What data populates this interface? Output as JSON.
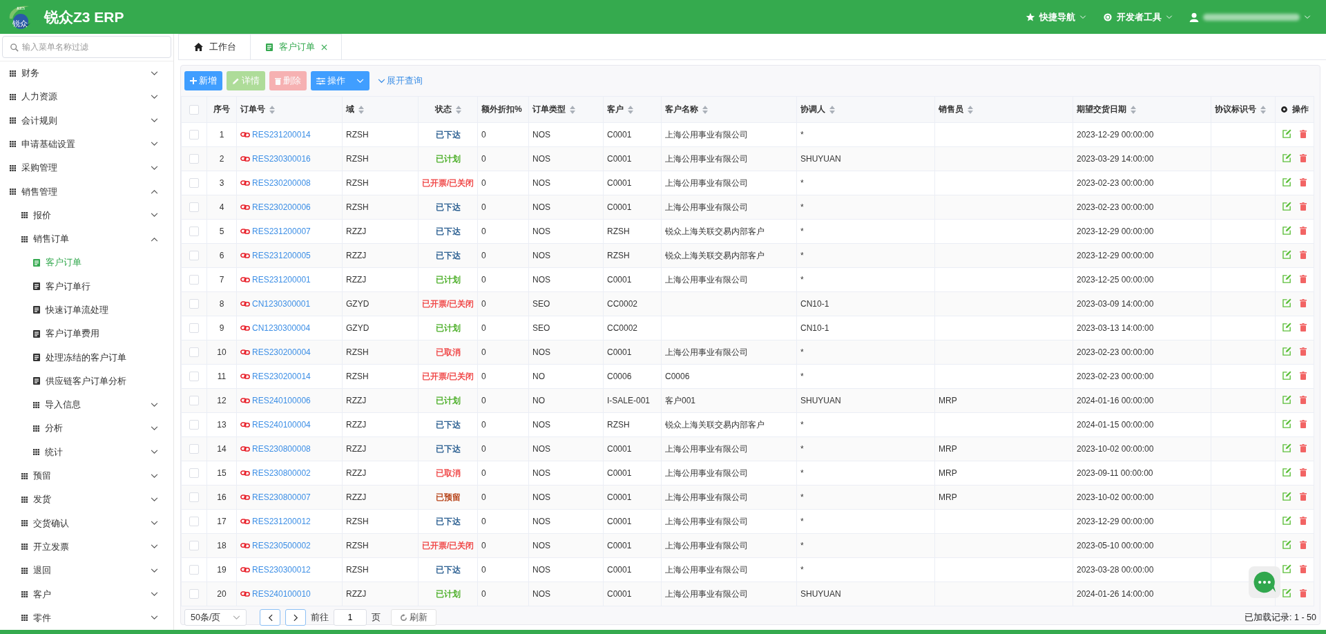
{
  "header": {
    "logo_text": [
      "RES",
      "锐众"
    ],
    "title": "锐众Z3 ERP",
    "menus": [
      {
        "kind": "star",
        "label": "快捷导航"
      },
      {
        "kind": "dev",
        "label": "开发者工具"
      },
      {
        "kind": "user"
      }
    ]
  },
  "sidebar": {
    "search": {
      "placeholder": "输入菜单名称过滤"
    },
    "items": [
      {
        "kind": "folder",
        "label": "财务",
        "expanded": false
      },
      {
        "kind": "folder",
        "label": "人力资源",
        "expanded": false
      },
      {
        "kind": "folder",
        "label": "会计规则",
        "expanded": false
      },
      {
        "kind": "folder",
        "label": "申请基础设置",
        "expanded": false
      },
      {
        "kind": "folder",
        "label": "采购管理",
        "expanded": false
      },
      {
        "kind": "folder",
        "label": "销售管理",
        "expanded": true,
        "children": [
          {
            "kind": "folder",
            "label": "报价",
            "expanded": false
          },
          {
            "kind": "folder",
            "label": "销售订单",
            "expanded": true,
            "children": [
              {
                "kind": "page",
                "label": "客户订单",
                "selected": true
              },
              {
                "kind": "page",
                "label": "客户订单行",
                "selected": false
              },
              {
                "kind": "page",
                "label": "快速订单流处理",
                "selected": false
              },
              {
                "kind": "page",
                "label": "客户订单费用",
                "selected": false
              },
              {
                "kind": "page",
                "label": "处理冻结的客户订单",
                "selected": false
              },
              {
                "kind": "page",
                "label": "供应链客户订单分析",
                "selected": false
              },
              {
                "kind": "folder",
                "label": "导入信息",
                "expanded": false
              },
              {
                "kind": "folder",
                "label": "分析",
                "expanded": false
              },
              {
                "kind": "folder",
                "label": "统计",
                "expanded": false
              }
            ]
          },
          {
            "kind": "folder",
            "label": "预留",
            "expanded": false
          },
          {
            "kind": "folder",
            "label": "发货",
            "expanded": false
          },
          {
            "kind": "folder",
            "label": "交货确认",
            "expanded": false
          },
          {
            "kind": "folder",
            "label": "开立发票",
            "expanded": false
          },
          {
            "kind": "folder",
            "label": "退回",
            "expanded": false
          },
          {
            "kind": "folder",
            "label": "客户",
            "expanded": false
          },
          {
            "kind": "folder",
            "label": "零件",
            "expanded": false
          }
        ]
      }
    ]
  },
  "tabs": [
    {
      "kind": "home",
      "label": "工作台",
      "selected": false,
      "closable": false
    },
    {
      "kind": "doc",
      "label": "客户订单",
      "selected": true,
      "closable": true
    }
  ],
  "toolbar": {
    "buttons": [
      {
        "kind": "add",
        "label": "新增",
        "disabled": false
      },
      {
        "kind": "edit",
        "label": "详情",
        "disabled": true
      },
      {
        "kind": "delete",
        "label": "删除",
        "disabled": true
      },
      {
        "kind": "menu",
        "label": "操作",
        "disabled": false
      }
    ],
    "expand_link": "展开查询"
  },
  "table": {
    "select_all_checked": false,
    "columns": [
      {
        "label": "序号",
        "sortable": false
      },
      {
        "label": "订单号",
        "sortable": true
      },
      {
        "label": "域",
        "sortable": true
      },
      {
        "label": "状态",
        "sortable": true
      },
      {
        "label": "额外折扣%",
        "sortable": false
      },
      {
        "label": "订单类型",
        "sortable": true
      },
      {
        "label": "客户",
        "sortable": true
      },
      {
        "label": "客户名称",
        "sortable": true
      },
      {
        "label": "协调人",
        "sortable": true
      },
      {
        "label": "销售员",
        "sortable": true
      },
      {
        "label": "期望交货日期",
        "sortable": true
      },
      {
        "label": "协议标识号",
        "sortable": true
      },
      {
        "label": "操作",
        "sortable": false
      }
    ],
    "rows": [
      {
        "checked": false,
        "cells": [
          "1",
          "RES231200014",
          "RZSH",
          "已下达",
          "0",
          "NOS",
          "C0001",
          "上海公用事业有限公司",
          "*",
          "",
          "2023-12-29 00:00:00",
          ""
        ],
        "color": "#2b5f91"
      },
      {
        "checked": false,
        "cells": [
          "2",
          "RES230300016",
          "RZSH",
          "已计划",
          "0",
          "NOS",
          "C0001",
          "上海公用事业有限公司",
          "SHUYUAN",
          "",
          "2023-03-29 14:00:00",
          ""
        ],
        "color": "#4fb02c"
      },
      {
        "checked": false,
        "cells": [
          "3",
          "RES230200008",
          "RZSH",
          "已开票/已关闭",
          "0",
          "NOS",
          "C0001",
          "上海公用事业有限公司",
          "*",
          "",
          "2023-02-23 00:00:00",
          ""
        ],
        "color": "#f04a4a"
      },
      {
        "checked": false,
        "cells": [
          "4",
          "RES230200006",
          "RZSH",
          "已下达",
          "0",
          "NOS",
          "C0001",
          "上海公用事业有限公司",
          "*",
          "",
          "2023-02-23 00:00:00",
          ""
        ],
        "color": "#2b5f91"
      },
      {
        "checked": false,
        "cells": [
          "5",
          "RES231200007",
          "RZZJ",
          "已下达",
          "0",
          "NOS",
          "RZSH",
          "锐众上海关联交易内部客户",
          "*",
          "",
          "2023-12-29 00:00:00",
          ""
        ],
        "color": "#2b5f91"
      },
      {
        "checked": false,
        "cells": [
          "6",
          "RES231200005",
          "RZZJ",
          "已下达",
          "0",
          "NOS",
          "RZSH",
          "锐众上海关联交易内部客户",
          "*",
          "",
          "2023-12-29 00:00:00",
          ""
        ],
        "color": "#2b5f91"
      },
      {
        "checked": false,
        "cells": [
          "7",
          "RES231200001",
          "RZZJ",
          "已计划",
          "0",
          "NOS",
          "C0001",
          "上海公用事业有限公司",
          "*",
          "",
          "2023-12-25 00:00:00",
          ""
        ],
        "color": "#4fb02c"
      },
      {
        "checked": false,
        "cells": [
          "8",
          "CN1230300001",
          "GZYD",
          "已开票/已关闭",
          "0",
          "SEO",
          "CC0002",
          "",
          "CN10-1",
          "",
          "2023-03-09 14:00:00",
          ""
        ],
        "color": "#f04a4a"
      },
      {
        "checked": false,
        "cells": [
          "9",
          "CN1230300004",
          "GZYD",
          "已计划",
          "0",
          "SEO",
          "CC0002",
          "",
          "CN10-1",
          "",
          "2023-03-13 14:00:00",
          ""
        ],
        "color": "#4fb02c"
      },
      {
        "checked": false,
        "cells": [
          "10",
          "RES230200004",
          "RZSH",
          "已取消",
          "0",
          "NOS",
          "C0001",
          "上海公用事业有限公司",
          "*",
          "",
          "2023-02-23 00:00:00",
          ""
        ],
        "color": "#f04a4a"
      },
      {
        "checked": false,
        "cells": [
          "11",
          "RES230200014",
          "RZSH",
          "已开票/已关闭",
          "0",
          "NO",
          "C0006",
          "C0006",
          "*",
          "",
          "2023-02-23 00:00:00",
          ""
        ],
        "color": "#f04a4a"
      },
      {
        "checked": false,
        "cells": [
          "12",
          "RES240100006",
          "RZZJ",
          "已计划",
          "0",
          "NO",
          "I-SALE-001",
          "客户001",
          "SHUYUAN",
          "MRP",
          "2024-01-16 00:00:00",
          ""
        ],
        "color": "#4fb02c"
      },
      {
        "checked": false,
        "cells": [
          "13",
          "RES240100004",
          "RZZJ",
          "已下达",
          "0",
          "NOS",
          "RZSH",
          "锐众上海关联交易内部客户",
          "*",
          "",
          "2024-01-15 00:00:00",
          ""
        ],
        "color": "#2b5f91"
      },
      {
        "checked": false,
        "cells": [
          "14",
          "RES230800008",
          "RZZJ",
          "已下达",
          "0",
          "NOS",
          "C0001",
          "上海公用事业有限公司",
          "*",
          "MRP",
          "2023-10-02 00:00:00",
          ""
        ],
        "color": "#2b5f91"
      },
      {
        "checked": false,
        "cells": [
          "15",
          "RES230800002",
          "RZZJ",
          "已取消",
          "0",
          "NOS",
          "C0001",
          "上海公用事业有限公司",
          "*",
          "MRP",
          "2023-09-11 00:00:00",
          ""
        ],
        "color": "#f04a4a"
      },
      {
        "checked": false,
        "cells": [
          "16",
          "RES230800007",
          "RZZJ",
          "已预留",
          "0",
          "NOS",
          "C0001",
          "上海公用事业有限公司",
          "*",
          "MRP",
          "2023-10-02 00:00:00",
          ""
        ],
        "color": "#b8461c"
      },
      {
        "checked": false,
        "cells": [
          "17",
          "RES231200012",
          "RZSH",
          "已下达",
          "0",
          "NOS",
          "C0001",
          "上海公用事业有限公司",
          "*",
          "",
          "2023-12-29 00:00:00",
          ""
        ],
        "color": "#2b5f91"
      },
      {
        "checked": false,
        "cells": [
          "18",
          "RES230500002",
          "RZSH",
          "已开票/已关闭",
          "0",
          "NOS",
          "C0001",
          "上海公用事业有限公司",
          "*",
          "",
          "2023-05-10 00:00:00",
          ""
        ],
        "color": "#f04a4a"
      },
      {
        "checked": false,
        "cells": [
          "19",
          "RES230300012",
          "RZSH",
          "已下达",
          "0",
          "NOS",
          "C0001",
          "上海公用事业有限公司",
          "*",
          "",
          "2023-03-28 00:00:00",
          ""
        ],
        "color": "#2b5f91"
      },
      {
        "checked": false,
        "cells": [
          "20",
          "RES240100010",
          "RZZJ",
          "已计划",
          "0",
          "NOS",
          "C0001",
          "上海公用事业有限公司",
          "SHUYUAN",
          "",
          "2024-01-26 14:00:00",
          ""
        ],
        "color": "#4fb02c"
      }
    ]
  },
  "pager": {
    "page_size": "50条/页",
    "goto_label": "前往",
    "page": "1",
    "page_unit": "页",
    "refresh": "刷新",
    "records": "已加载记录: 1 - 50"
  }
}
